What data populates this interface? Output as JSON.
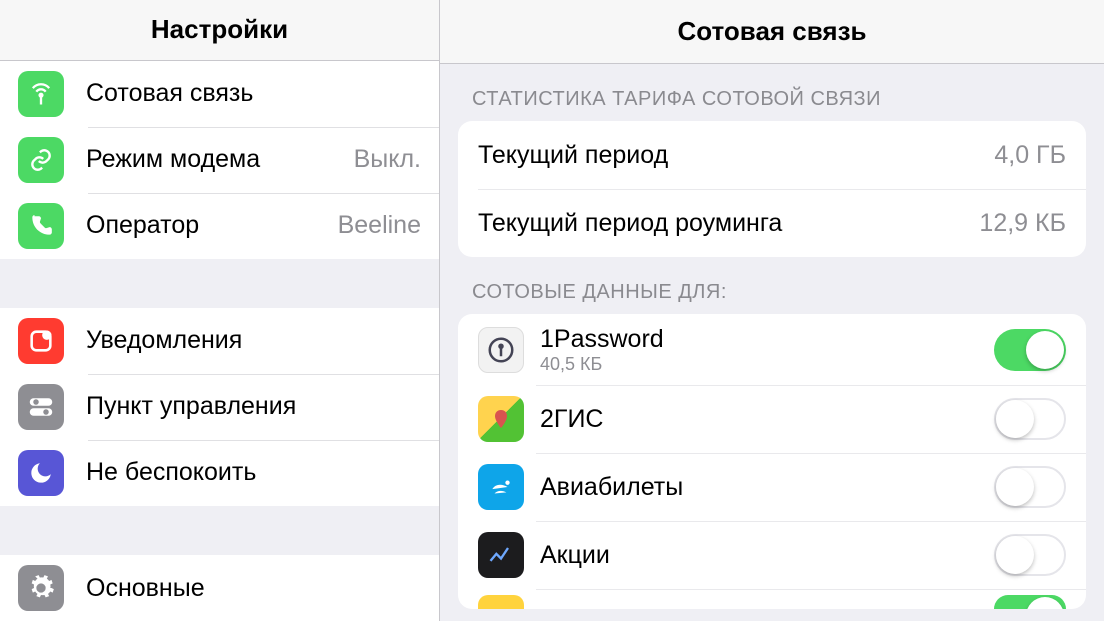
{
  "sidebar": {
    "title": "Настройки",
    "group1": [
      {
        "id": "cellular",
        "label": "Сотовая связь",
        "value": "",
        "icon": "antenna",
        "color": "ic-green"
      },
      {
        "id": "hotspot",
        "label": "Режим модема",
        "value": "Выкл.",
        "icon": "link",
        "color": "ic-green2"
      },
      {
        "id": "carrier",
        "label": "Оператор",
        "value": "Beeline",
        "icon": "phone",
        "color": "ic-green3"
      }
    ],
    "group2": [
      {
        "id": "notifications",
        "label": "Уведомления",
        "value": "",
        "icon": "notif",
        "color": "ic-red"
      },
      {
        "id": "control-center",
        "label": "Пункт управления",
        "value": "",
        "icon": "toggles",
        "color": "ic-gray"
      },
      {
        "id": "dnd",
        "label": "Не беспокоить",
        "value": "",
        "icon": "moon",
        "color": "ic-purple"
      }
    ],
    "group3": [
      {
        "id": "general",
        "label": "Основные",
        "value": "",
        "icon": "gear",
        "color": "ic-graylight"
      }
    ]
  },
  "detail": {
    "title": "Сотовая связь",
    "stats_header": "СТАТИСТИКА ТАРИФА СОТОВОЙ СВЯЗИ",
    "stats": [
      {
        "label": "Текущий период",
        "value": "4,0 ГБ"
      },
      {
        "label": "Текущий период роуминга",
        "value": "12,9 КБ"
      }
    ],
    "apps_header": "СОТОВЫЕ ДАННЫЕ ДЛЯ:",
    "apps": [
      {
        "name": "1Password",
        "sub": "40,5 КБ",
        "on": true,
        "iconClass": "ic-1pw"
      },
      {
        "name": "2ГИС",
        "sub": "",
        "on": false,
        "iconClass": "ic-2gis"
      },
      {
        "name": "Авиабилеты",
        "sub": "",
        "on": false,
        "iconClass": "ic-sky"
      },
      {
        "name": "Акции",
        "sub": "",
        "on": false,
        "iconClass": "ic-stocks"
      },
      {
        "name": "",
        "sub": "",
        "on": true,
        "iconClass": "ic-yellow"
      }
    ]
  }
}
